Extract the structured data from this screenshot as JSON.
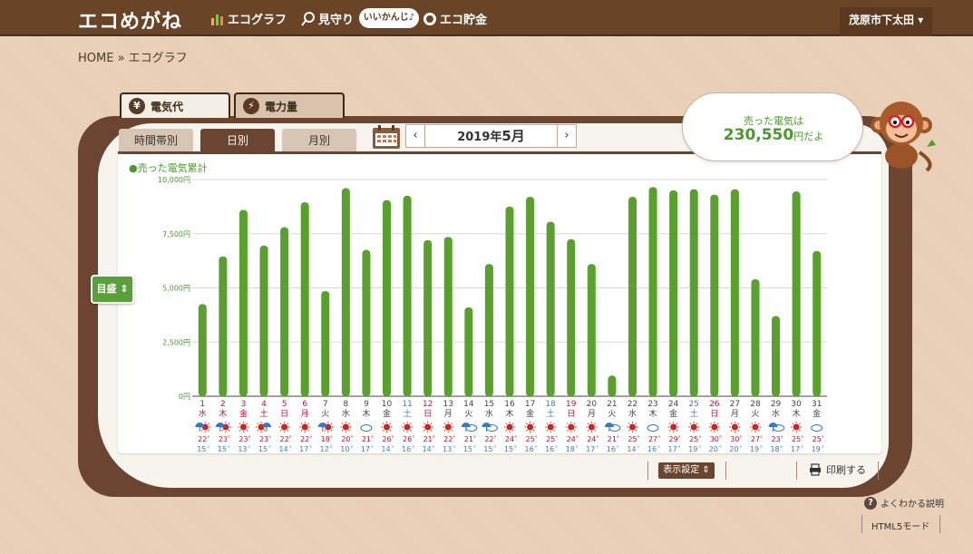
{
  "header": {
    "logo": "エコめがね",
    "nav": [
      {
        "label": "エコグラフ",
        "icon": "bar-chart-icon"
      },
      {
        "label": "見守り",
        "icon": "magnifier-icon"
      },
      {
        "label": "エコ貯金",
        "icon": "piggy-bank-icon"
      }
    ],
    "pill": "いいかんじ♪",
    "location": "茂原市下太田",
    "location_icon": "caret-down-icon"
  },
  "breadcrumb": "HOME » エコグラフ",
  "tabs": {
    "main": [
      "電気代",
      "電力量"
    ],
    "main_icons": [
      "yen-icon",
      "lightning-icon"
    ],
    "sub": [
      "時間帯別",
      "日別",
      "月別"
    ],
    "active_sub": "日別"
  },
  "month_nav": {
    "year_part": "2019年",
    "month_part": "5月",
    "prev": "‹",
    "next": "›"
  },
  "series_label": "売った電気累計",
  "scale_button": "目盛 ⇕",
  "summary": {
    "line1": "売った電気は",
    "value": "230,550",
    "unit": "円だよ"
  },
  "footer": {
    "display_settings": "表示設定 ⇕",
    "print": "印刷する",
    "faq": "よくわかる説明",
    "html5": "HTML5モード"
  },
  "colors": {
    "bar": "#5aa02c",
    "saturday": "#3a7ec8",
    "sunday": "#c8102e",
    "brown": "#6b4530"
  },
  "chart_data": {
    "type": "bar",
    "ylim": [
      0,
      10000
    ],
    "yticks": [
      "0円",
      "2,500円",
      "5,000円",
      "7,500円",
      "10,000円"
    ],
    "categories": [
      "1",
      "2",
      "3",
      "4",
      "5",
      "6",
      "7",
      "8",
      "9",
      "10",
      "11",
      "12",
      "13",
      "14",
      "15",
      "16",
      "17",
      "18",
      "19",
      "20",
      "21",
      "22",
      "23",
      "24",
      "25",
      "26",
      "27",
      "28",
      "29",
      "30",
      "31"
    ],
    "weekdays": [
      "水",
      "木",
      "金",
      "土",
      "日",
      "月",
      "火",
      "水",
      "木",
      "金",
      "土",
      "日",
      "月",
      "火",
      "水",
      "木",
      "金",
      "土",
      "日",
      "月",
      "火",
      "水",
      "木",
      "金",
      "土",
      "日",
      "月",
      "火",
      "水",
      "木",
      "金"
    ],
    "day_types": [
      "holiday",
      "holiday",
      "holiday",
      "holiday",
      "holiday",
      "holiday",
      "weekday",
      "weekday",
      "weekday",
      "weekday",
      "saturday",
      "sunday",
      "weekday",
      "weekday",
      "weekday",
      "weekday",
      "weekday",
      "saturday",
      "sunday",
      "weekday",
      "weekday",
      "weekday",
      "weekday",
      "weekday",
      "saturday",
      "sunday",
      "weekday",
      "weekday",
      "weekday",
      "weekday",
      "weekday"
    ],
    "values": [
      4250,
      6450,
      8600,
      6950,
      7800,
      8950,
      4850,
      9600,
      6750,
      9050,
      9250,
      7200,
      7350,
      4100,
      6100,
      8750,
      9200,
      8050,
      7250,
      6100,
      950,
      9200,
      9650,
      9500,
      9550,
      9300,
      9550,
      5400,
      3700,
      9450,
      6700
    ],
    "weather": [
      "umbrella-sun",
      "umbrella-sun",
      "sun",
      "sun-umbrella",
      "sun",
      "sun",
      "umbrella-sun",
      "sun",
      "cloud",
      "sun",
      "sun",
      "sun",
      "sun",
      "umbrella-cloud",
      "umbrella-cloud",
      "sun",
      "sun",
      "sun",
      "sun",
      "sun",
      "umbrella-cloud",
      "sun",
      "cloud",
      "sun",
      "sun",
      "sun",
      "sun",
      "sun",
      "umbrella-cloud",
      "sun",
      "cloud"
    ],
    "high_temps": [
      22,
      23,
      23,
      23,
      22,
      22,
      18,
      20,
      21,
      26,
      26,
      21,
      22,
      21,
      22,
      24,
      25,
      25,
      24,
      24,
      21,
      25,
      27,
      29,
      25,
      30,
      30,
      27,
      23,
      25,
      25
    ],
    "low_temps": [
      15,
      15,
      13,
      15,
      14,
      17,
      12,
      10,
      17,
      14,
      16,
      14,
      13,
      15,
      15,
      15,
      16,
      16,
      18,
      17,
      16,
      14,
      16,
      17,
      19,
      20,
      20,
      19,
      18,
      17,
      19
    ],
    "temp_unit": "°"
  }
}
